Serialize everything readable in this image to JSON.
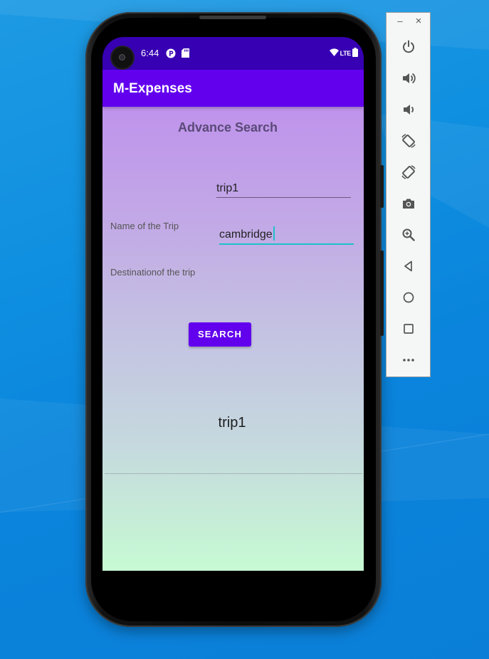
{
  "status_bar": {
    "time": "6:44",
    "network_label": "LTE",
    "icons": [
      "camera-cutout-icon",
      "notification-p-icon",
      "sd-card-icon",
      "wifi-icon",
      "lte-icon",
      "battery-icon"
    ]
  },
  "app_bar": {
    "title": "M-Expenses"
  },
  "search_screen": {
    "heading": "Advance Search",
    "name_label": "Name of the Trip",
    "name_value": "trip1",
    "destination_label": "Destinationof the trip",
    "destination_value": "cambridge",
    "search_button_label": "SEARCH",
    "results": [
      "trip1"
    ]
  },
  "emulator_toolbar": {
    "window_controls": [
      "minimize-icon",
      "close-icon"
    ],
    "minimize_glyph": "–",
    "close_glyph": "×",
    "buttons": [
      "power-icon",
      "volume-up-icon",
      "volume-down-icon",
      "rotate-left-icon",
      "rotate-right-icon",
      "screenshot-camera-icon",
      "zoom-icon",
      "back-icon",
      "home-icon",
      "overview-icon",
      "more-icon"
    ]
  },
  "colors": {
    "primary": "#6200ee",
    "primary_dark": "#3700b3",
    "focus_underline": "#20c0c8",
    "background_gradient_top": "#bf93ec",
    "background_gradient_bottom": "#c7fbd4"
  }
}
